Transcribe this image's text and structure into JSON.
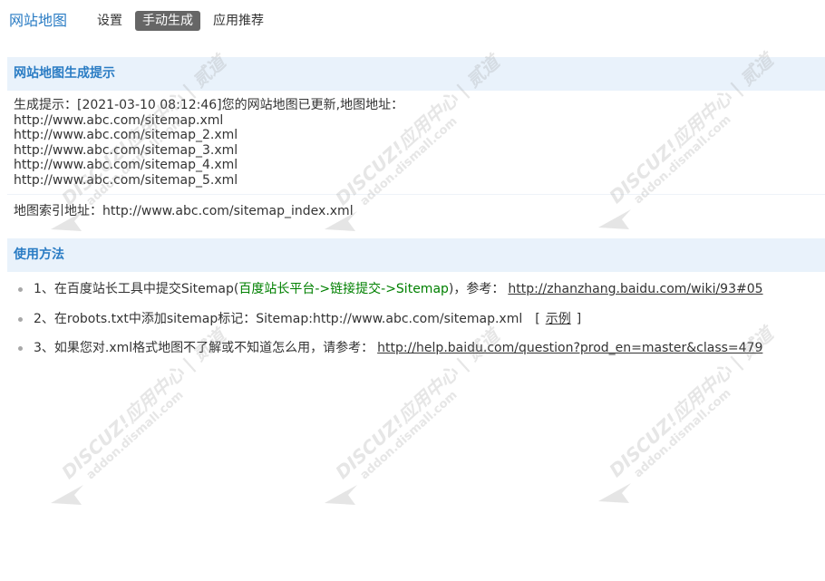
{
  "header": {
    "title": "网站地图",
    "tabs": [
      {
        "label": "设置",
        "active": false
      },
      {
        "label": "手动生成",
        "active": true
      },
      {
        "label": "应用推荐",
        "active": false
      }
    ]
  },
  "generate_section": {
    "title": "网站地图生成提示",
    "notice_label": "生成提示：",
    "notice_timestamp": "[2021-03-10 08:12:46]",
    "notice_message": "您的网站地图已更新,地图地址：",
    "sitemap_urls": [
      "http://www.abc.com/sitemap.xml",
      "http://www.abc.com/sitemap_2.xml",
      "http://www.abc.com/sitemap_3.xml",
      "http://www.abc.com/sitemap_4.xml",
      "http://www.abc.com/sitemap_5.xml"
    ],
    "index_label": "地图索引地址：",
    "index_url": "http://www.abc.com/sitemap_index.xml"
  },
  "usage_section": {
    "title": "使用方法",
    "steps": [
      {
        "prefix": "1、在百度站长工具中提交Sitemap(",
        "highlight": "百度站长平台->链接提交->Sitemap",
        "suffix": ")，参考：",
        "link": "http://zhanzhang.baidu.com/wiki/93#05"
      },
      {
        "prefix": "2、在robots.txt中添加sitemap标记：Sitemap:http://www.abc.com/sitemap.xml",
        "bracket_open": "[",
        "example_link": "示例",
        "bracket_close": "]"
      },
      {
        "prefix": "3、如果您对.xml格式地图不了解或不知道怎么用，请参考：",
        "link": "http://help.baidu.com/question?prod_en=master&class=479"
      }
    ]
  },
  "watermark": {
    "brand": "DISCUZ!应用中心",
    "separator": "|",
    "brand_cn": "贰道",
    "domain": "addon.dismall.com"
  },
  "icons": {
    "bullet": "bullet-dot-icon",
    "watermark_logo": "discuz-arrow-logo-icon"
  },
  "colors": {
    "accent": "#2a7cc4",
    "section_background": "#e9f2fb",
    "active_tab_background": "#666666",
    "highlight_green": "#008000",
    "text": "#333333"
  }
}
